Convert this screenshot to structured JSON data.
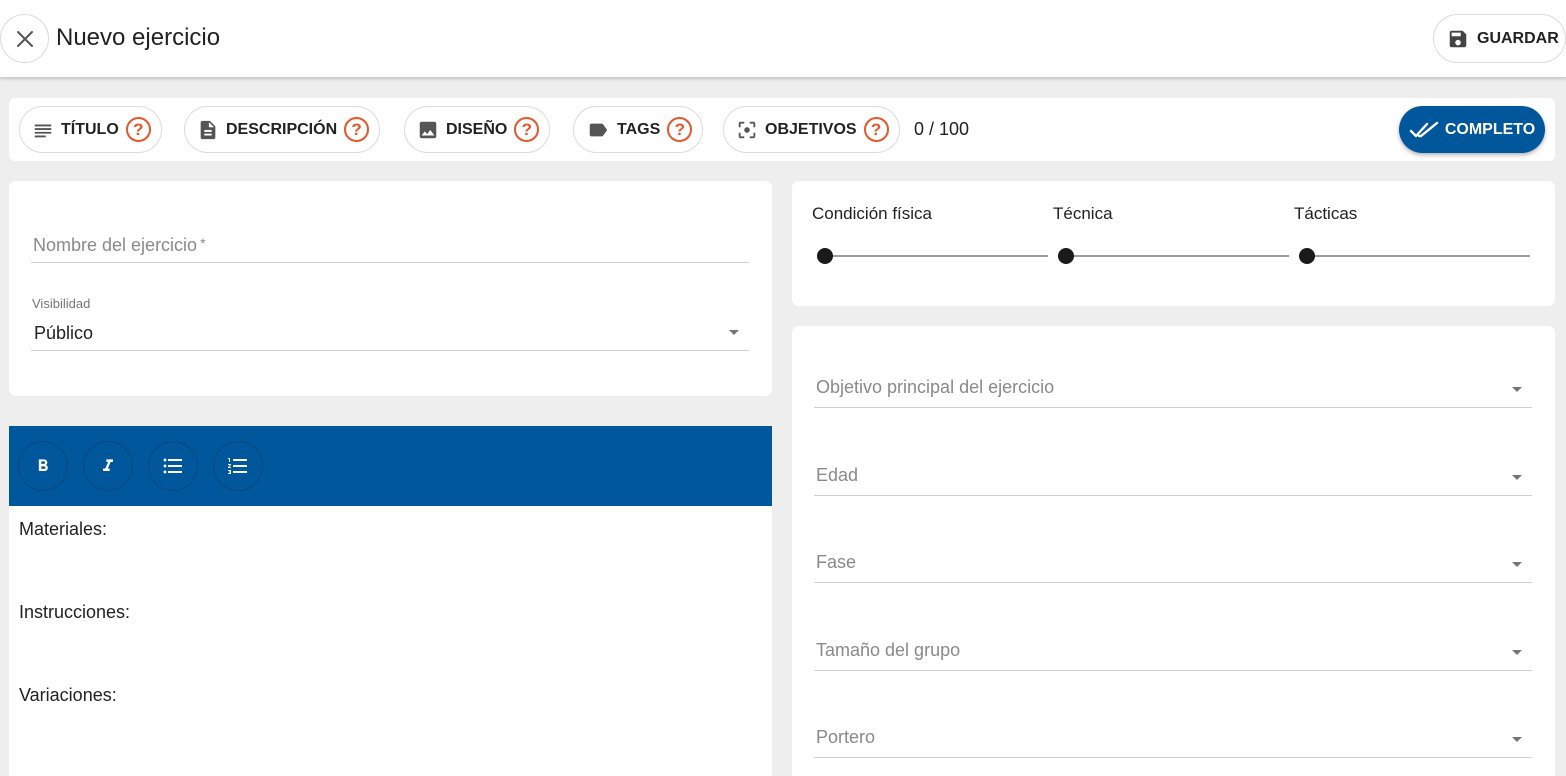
{
  "header": {
    "title": "Nuevo ejercicio",
    "save_label": "GUARDAR"
  },
  "steps": [
    {
      "label": "TÍTULO",
      "help": "?",
      "icon": "notes-lines-icon"
    },
    {
      "label": "DESCRIPCIÓN",
      "help": "?",
      "icon": "document-icon"
    },
    {
      "label": "DISEÑO",
      "help": "?",
      "icon": "image-icon"
    },
    {
      "label": "TAGS",
      "help": "?",
      "icon": "tag-icon"
    },
    {
      "label": "OBJETIVOS",
      "help": "?",
      "icon": "center-focus-icon"
    }
  ],
  "progress": {
    "text": "0 / 100"
  },
  "complete_label": "COMPLETO",
  "form": {
    "name_placeholder": "Nombre del ejercicio",
    "name_required_mark": "*",
    "visibility_label": "Visibilidad",
    "visibility_value": "Público"
  },
  "sliders": [
    {
      "label": "Condición física",
      "value": 0
    },
    {
      "label": "Técnica",
      "value": 0
    },
    {
      "label": "Tácticas",
      "value": 0
    }
  ],
  "selects": [
    {
      "placeholder": "Objetivo principal del ejercicio"
    },
    {
      "placeholder": "Edad"
    },
    {
      "placeholder": "Fase"
    },
    {
      "placeholder": "Tamaño del grupo"
    },
    {
      "placeholder": "Portero"
    }
  ],
  "editor": {
    "toolbar": [
      "bold",
      "italic",
      "bulleted-list",
      "numbered-list"
    ],
    "lines": [
      "Materiales:",
      "Instrucciones:",
      "Variaciones:"
    ]
  },
  "colors": {
    "accent": "#01579b",
    "help": "#e8562a",
    "background": "#eeeeee"
  }
}
